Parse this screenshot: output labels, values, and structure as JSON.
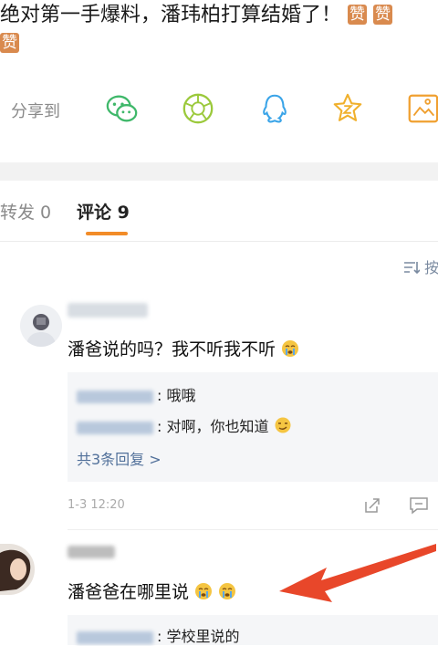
{
  "post": {
    "text": "绝对第一手爆料，潘玮柏打算结婚了！",
    "badge1": "赞",
    "badge2": "赞",
    "badge3": "赞"
  },
  "share": {
    "label": "分享到",
    "icons": [
      "wechat-icon",
      "moments-icon",
      "qq-icon",
      "qzone-icon",
      "save-image-icon"
    ]
  },
  "tabs": {
    "repost": "转发 0",
    "comment": "评论 9"
  },
  "sort_label": "按",
  "comments": [
    {
      "text": "潘爸说的吗？我不听我不听",
      "replies": [
        {
          "text": ": 哦哦"
        },
        {
          "text": ": 对啊，你也知道"
        }
      ],
      "more": "共3条回复 >",
      "time": "1-3 12:20"
    },
    {
      "text": "潘爸爸在哪里说",
      "replies": [
        {
          "text": ": 学校里说的"
        }
      ]
    }
  ],
  "colors": {
    "accent": "#f28c28",
    "link": "#51709a",
    "annotation_arrow": "#e8472a"
  }
}
